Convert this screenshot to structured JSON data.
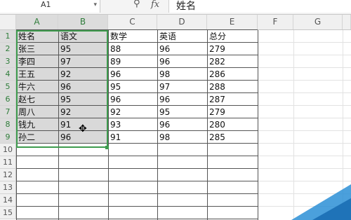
{
  "formula_bar": {
    "name_box": "A1",
    "value": "姓名"
  },
  "columns": [
    "A",
    "B",
    "C",
    "D",
    "E",
    "F",
    "G"
  ],
  "rows": [
    "1",
    "2",
    "3",
    "4",
    "5",
    "6",
    "7",
    "8",
    "9",
    "10",
    "11",
    "12",
    "13",
    "14",
    "15"
  ],
  "table": {
    "headers": [
      "姓名",
      "语文",
      "数学",
      "英语",
      "总分"
    ],
    "records": [
      [
        "张三",
        "95",
        "88",
        "96",
        "279"
      ],
      [
        "李四",
        "97",
        "89",
        "96",
        "282"
      ],
      [
        "王五",
        "92",
        "96",
        "98",
        "286"
      ],
      [
        "牛六",
        "96",
        "95",
        "97",
        "288"
      ],
      [
        "赵七",
        "95",
        "96",
        "96",
        "287"
      ],
      [
        "周八",
        "92",
        "92",
        "95",
        "279"
      ],
      [
        "钱九",
        "91",
        "93",
        "96",
        "280"
      ],
      [
        "孙二",
        "96",
        "91",
        "98",
        "285"
      ]
    ]
  },
  "selection": {
    "range": "A1:B9",
    "color": "#3e9b4e"
  },
  "icons": {
    "zoom": "zoom-icon",
    "fx": "fx-icon",
    "cursor": "move-cursor-icon"
  }
}
